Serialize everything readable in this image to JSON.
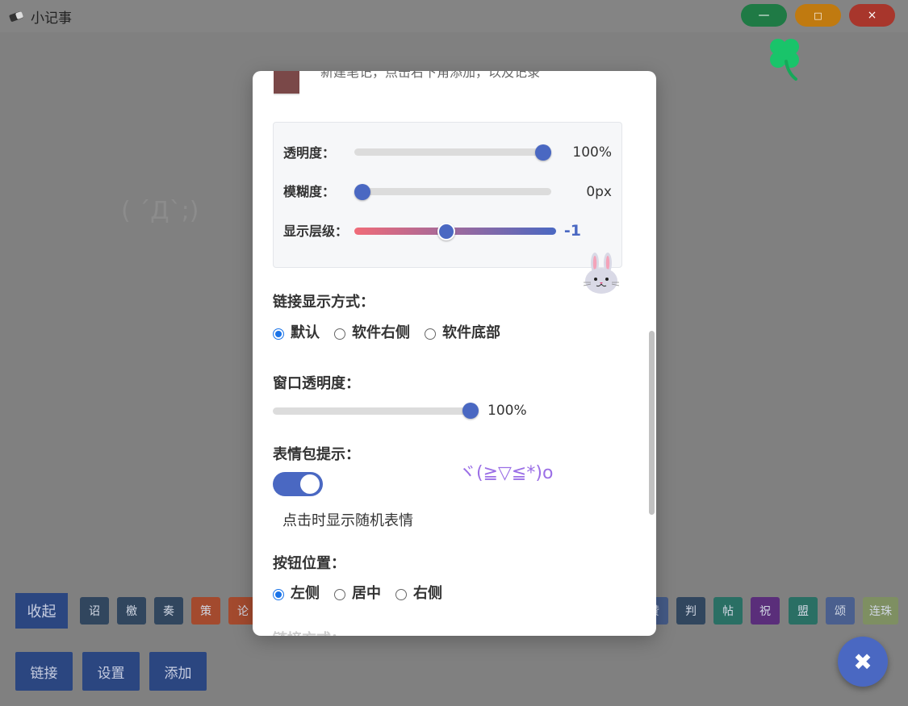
{
  "window": {
    "title": "小记事",
    "minimize_label": "—",
    "maximize_label": "□",
    "close_label": "×"
  },
  "background": {
    "emote": "( ´Д`;)"
  },
  "toolbar": {
    "collapse_label": "收起",
    "chips": [
      {
        "label": "诏",
        "color": "#31465e"
      },
      {
        "label": "檄",
        "color": "#31465e"
      },
      {
        "label": "奏",
        "color": "#31465e"
      },
      {
        "label": "策",
        "color": "#a34a2e"
      },
      {
        "label": "论",
        "color": "#a34a2e"
      },
      {
        "label": "赞",
        "color": "#445a86"
      },
      {
        "label": "判",
        "color": "#31465e"
      },
      {
        "label": "帖",
        "color": "#2a6f64"
      },
      {
        "label": "祝",
        "color": "#5a2e7a"
      },
      {
        "label": "盟",
        "color": "#2a6f64"
      },
      {
        "label": "颂",
        "color": "#4a5f8e"
      },
      {
        "label": "连珠",
        "color": "#7e8f62"
      }
    ],
    "link_label": "链接",
    "settings_label": "设置",
    "add_label": "添加",
    "fab_label": "✖"
  },
  "modal": {
    "swatch_color": "#7a4848",
    "swatch_text": "新建笔记，点击右下角添加，以及记录",
    "opacity": {
      "label": "透明度：",
      "value": "100%",
      "level": 1.0
    },
    "blur": {
      "label": "模糊度：",
      "value": "0px",
      "level": 0.0
    },
    "layer": {
      "label": "显示层级：",
      "value": "-1",
      "level": 0.45
    },
    "link_mode": {
      "label": "链接显示方式：",
      "options": [
        "默认",
        "软件右侧",
        "软件底部"
      ],
      "selected": 0
    },
    "window_opacity": {
      "label": "窗口透明度：",
      "value": "100%",
      "level": 1.0
    },
    "emoji_hint": {
      "label": "表情包提示：",
      "enabled": true,
      "kaomoji": "ヾ(≧▽≦*)o",
      "description": "点击时显示随机表情"
    },
    "button_position": {
      "label": "按钮位置：",
      "options": [
        "左侧",
        "居中",
        "右侧"
      ],
      "selected": 0
    },
    "next_label": "链接方式："
  }
}
